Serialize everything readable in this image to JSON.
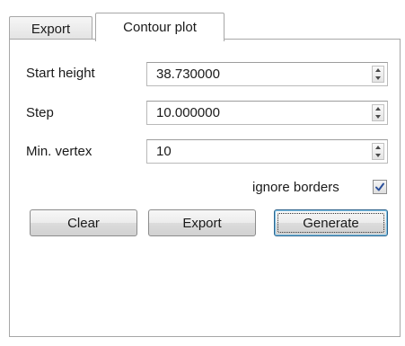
{
  "tabs": [
    {
      "label": "Export",
      "active": false
    },
    {
      "label": "Contour plot",
      "active": true
    }
  ],
  "fields": {
    "start_height": {
      "label": "Start height",
      "value": "38.730000"
    },
    "step": {
      "label": "Step",
      "value": "10.000000"
    },
    "min_vertex": {
      "label": "Min. vertex",
      "value": "10"
    }
  },
  "ignore_borders": {
    "label": "ignore borders",
    "checked": true
  },
  "buttons": {
    "clear": "Clear",
    "export": "Export",
    "generate": "Generate"
  },
  "colors": {
    "checkmark": "#2a4f9a",
    "focused_button_border": "#2c628b"
  },
  "icons": {
    "spin_up": "up-arrow-icon",
    "spin_down": "down-arrow-icon",
    "check": "checkmark-icon"
  }
}
